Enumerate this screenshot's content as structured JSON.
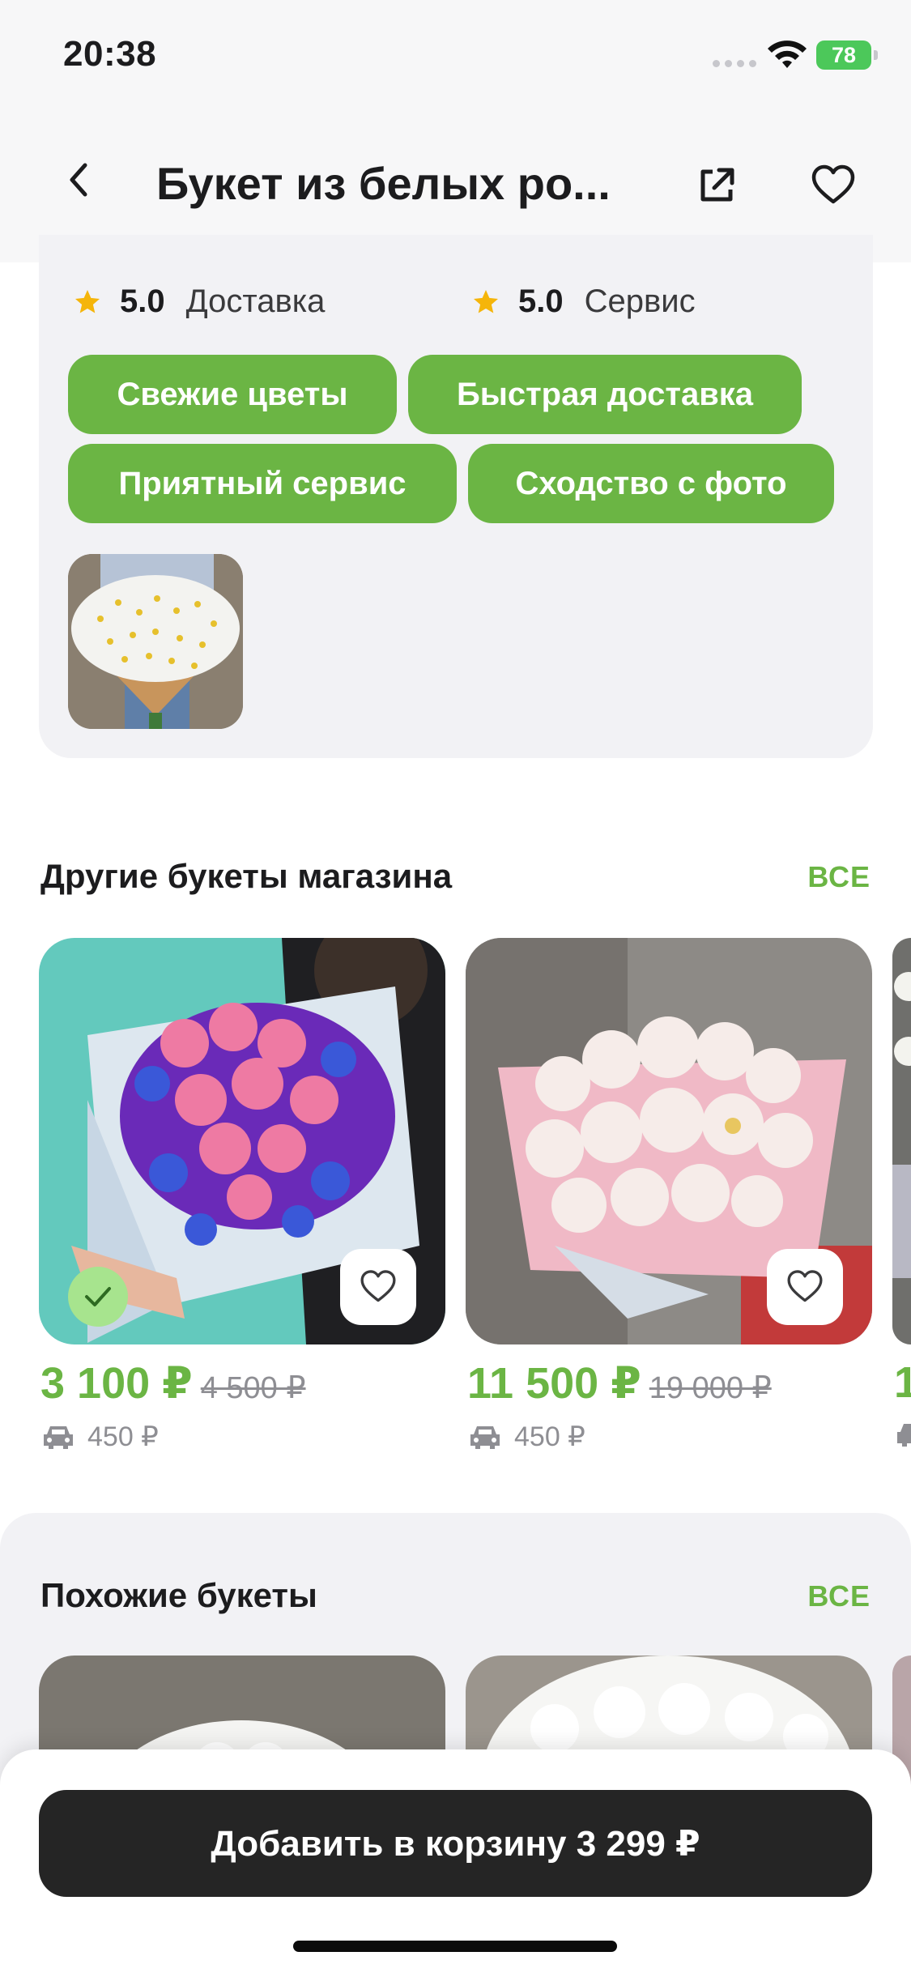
{
  "status_bar": {
    "time": "20:38",
    "battery": "78"
  },
  "header": {
    "title": "Букет из белых ро...",
    "back_icon": "chevron-left-icon",
    "share_icon": "share-icon",
    "favorite_icon": "heart-icon"
  },
  "reviews": {
    "ratings": [
      {
        "score": "5.0",
        "label": "Доставка"
      },
      {
        "score": "5.0",
        "label": "Сервис"
      }
    ],
    "tags": [
      "Свежие цветы",
      "Быстрая доставка",
      "Приятный сервис",
      "Сходство с фото"
    ]
  },
  "other_bouquets": {
    "title": "Другие букеты магазина",
    "see_all": "ВСЕ",
    "items": [
      {
        "price": "3 100 ₽",
        "old_price": "4 500 ₽",
        "delivery": "450 ₽"
      },
      {
        "price": "11 500 ₽",
        "old_price": "19 000 ₽",
        "delivery": "450 ₽"
      },
      {
        "price": "1"
      }
    ]
  },
  "similar_bouquets": {
    "title": "Похожие букеты",
    "see_all": "ВСЕ"
  },
  "cart": {
    "button_label": "Добавить в корзину 3 299 ₽"
  },
  "colors": {
    "accent": "#6bb544",
    "dark_button": "#252525",
    "card_bg": "#f2f2f5"
  }
}
